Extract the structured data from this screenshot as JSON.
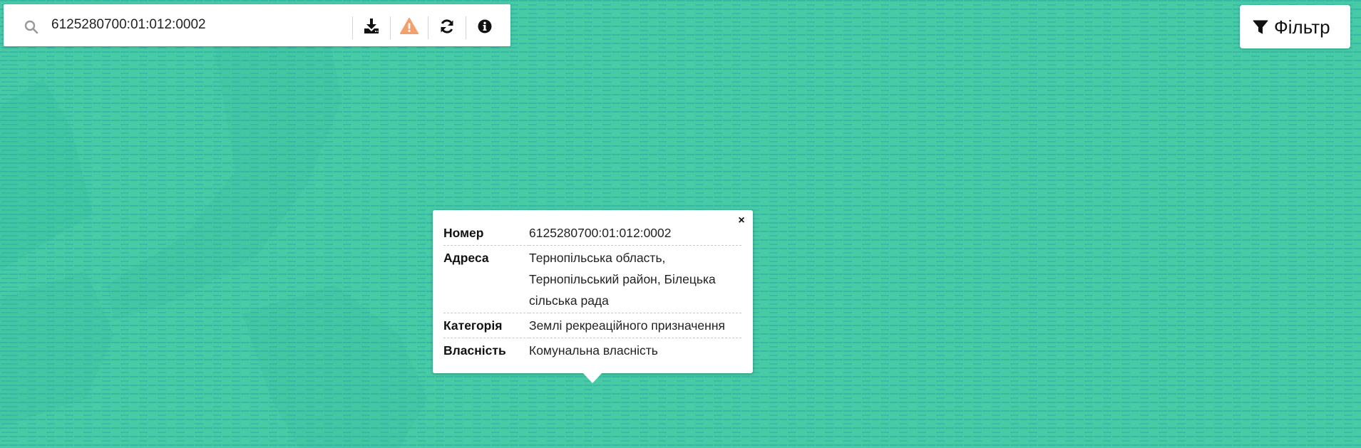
{
  "search": {
    "value": "6125280700:01:012:0002",
    "icons": {
      "search": "search-icon",
      "download": "download-icon",
      "warning": "warning-icon",
      "refresh": "refresh-icon",
      "info": "info-icon"
    }
  },
  "filter": {
    "icon": "filter-icon",
    "label": "Фільтр"
  },
  "popup": {
    "close_label": "×",
    "rows": [
      {
        "key": "Номер",
        "value": "6125280700:01:012:0002"
      },
      {
        "key": "Адреса",
        "value": "Тернопільська область, Тернопільський район, Білецька сільська рада"
      },
      {
        "key": "Категорія",
        "value": "Землі рекреаційного призначення"
      },
      {
        "key": "Власність",
        "value": "Комунальна власність"
      }
    ]
  },
  "colors": {
    "map_background": "#47cba5",
    "map_darker_patch": "#3fc3a0",
    "warning_icon": "#f2a16d",
    "icon_dark": "#111111"
  }
}
